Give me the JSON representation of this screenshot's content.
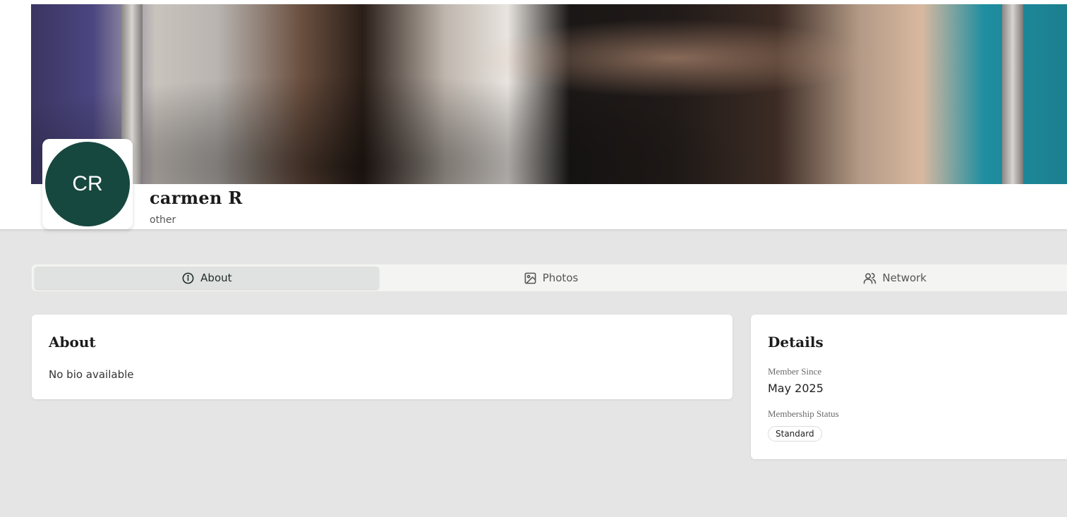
{
  "profile": {
    "initials": "CR",
    "name": "carmen R",
    "role": "other"
  },
  "tabs": [
    {
      "label": "About",
      "icon": "info-icon",
      "active": true
    },
    {
      "label": "Photos",
      "icon": "image-icon",
      "active": false
    },
    {
      "label": "Network",
      "icon": "users-icon",
      "active": false
    }
  ],
  "about": {
    "title": "About",
    "bio": "No bio available"
  },
  "details": {
    "title": "Details",
    "member_since_label": "Member Since",
    "member_since_value": "May 2025",
    "status_label": "Membership Status",
    "status_value": "Standard"
  },
  "colors": {
    "avatar_bg": "#174840",
    "page_bg": "#e5e5e5",
    "active_tab_bg": "#dfe2e0"
  }
}
